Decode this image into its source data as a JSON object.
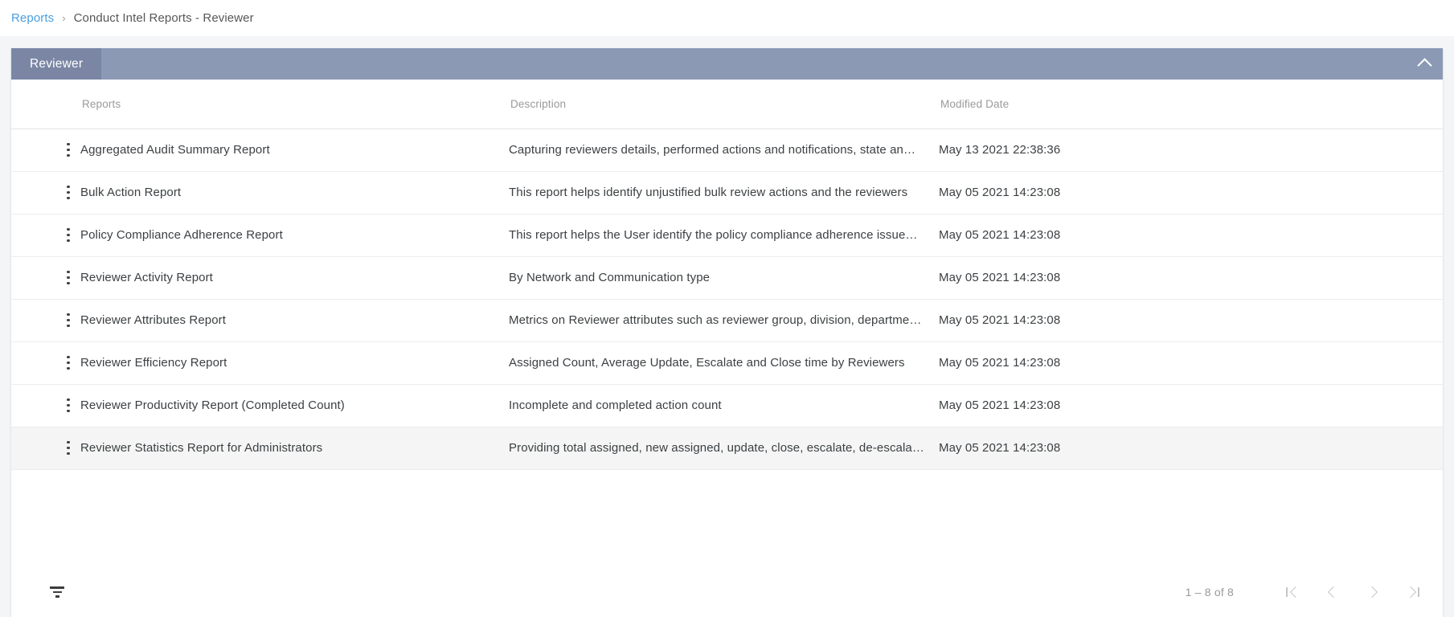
{
  "breadcrumb": {
    "root_label": "Reports",
    "separator": "›",
    "current_label": "Conduct Intel Reports - Reviewer"
  },
  "panel": {
    "tab_label": "Reviewer",
    "collapse_icon": "chevron-up-icon",
    "header_color": "#8b99b5",
    "tab_color": "#7a86a4"
  },
  "table": {
    "columns": [
      "Reports",
      "Description",
      "Modified Date"
    ],
    "rows": [
      {
        "name": "Aggregated Audit Summary Report",
        "description": "Capturing reviewers details, performed actions and notifications, state an…",
        "modified": "May 13 2021 22:38:36",
        "selected": false
      },
      {
        "name": "Bulk Action Report",
        "description": "This report helps identify unjustified bulk review actions and the reviewers",
        "modified": "May 05 2021 14:23:08",
        "selected": false
      },
      {
        "name": "Policy Compliance Adherence Report",
        "description": "This report helps the User identify the policy compliance adherence issue…",
        "modified": "May 05 2021 14:23:08",
        "selected": false
      },
      {
        "name": "Reviewer Activity Report",
        "description": "By Network and Communication type",
        "modified": "May 05 2021 14:23:08",
        "selected": false
      },
      {
        "name": "Reviewer Attributes Report",
        "description": "Metrics on Reviewer attributes such as reviewer group, division, departme…",
        "modified": "May 05 2021 14:23:08",
        "selected": false
      },
      {
        "name": "Reviewer Efficiency Report",
        "description": "Assigned Count, Average Update, Escalate and Close time by Reviewers",
        "modified": "May 05 2021 14:23:08",
        "selected": false
      },
      {
        "name": "Reviewer Productivity Report (Completed Count)",
        "description": "Incomplete and completed action count",
        "modified": "May 05 2021 14:23:08",
        "selected": false
      },
      {
        "name": "Reviewer Statistics Report for Administrators",
        "description": "Providing total assigned, new assigned, update, close, escalate, de-escala…",
        "modified": "May 05 2021 14:23:08",
        "selected": true
      }
    ],
    "row_menu_icon": "kebab-menu-icon"
  },
  "footer": {
    "filter_icon": "filter-funnel-icon",
    "range_label": "1 – 8 of 8",
    "first_page_icon": "first-page-icon",
    "prev_page_icon": "previous-page-icon",
    "next_page_icon": "next-page-icon",
    "last_page_icon": "last-page-icon"
  }
}
